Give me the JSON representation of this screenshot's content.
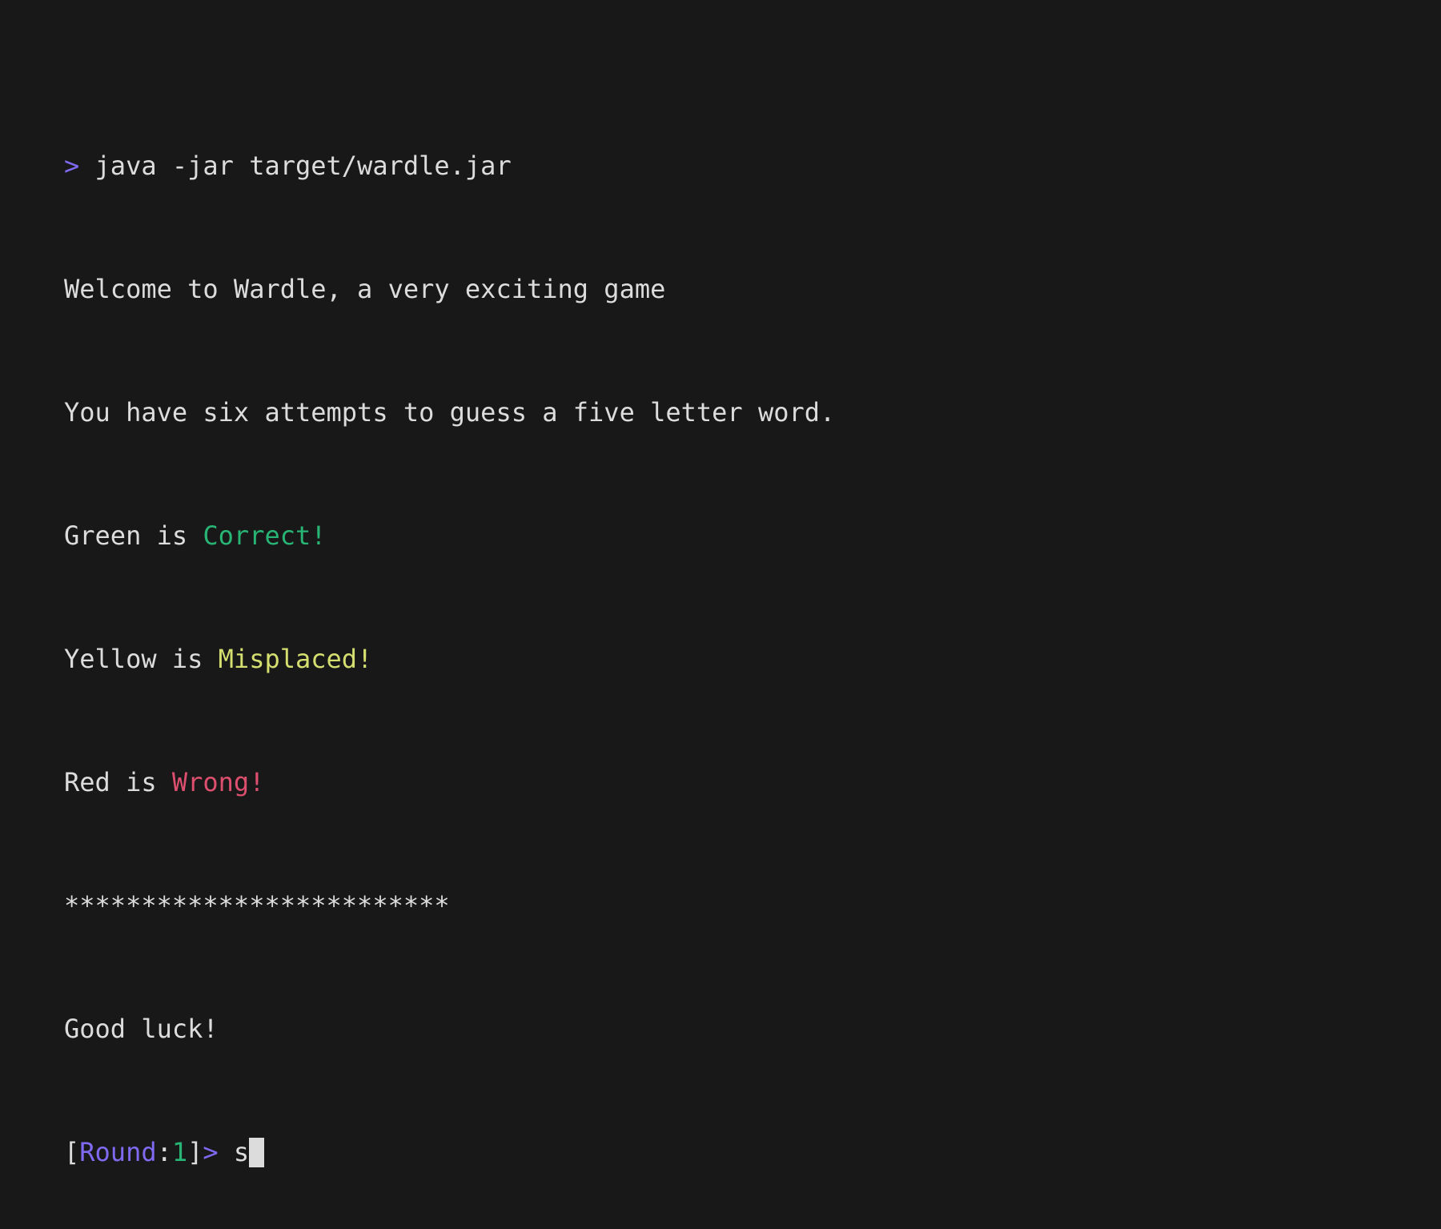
{
  "colors": {
    "background": "#181818",
    "foreground": "#dcdcdc",
    "prompt": "#7f6bf2",
    "correct": "#28b474",
    "misplaced": "#d4df6f",
    "wrong": "#dd4f6e"
  },
  "command": {
    "prompt": ">",
    "text": "java -jar target/wardle.jar"
  },
  "output": {
    "welcome": "Welcome to Wardle, a very exciting game",
    "rules": "You have six attempts to guess a five letter word.",
    "legend": [
      {
        "prefix": "Green is ",
        "word": "Correct!",
        "color_key": "correct"
      },
      {
        "prefix": "Yellow is ",
        "word": "Misplaced!",
        "color_key": "misplaced"
      },
      {
        "prefix": "Red is ",
        "word": "Wrong!",
        "color_key": "wrong"
      }
    ],
    "separator": "*************************",
    "good_luck": "Good luck!"
  },
  "round_prompt": {
    "open_bracket": "[",
    "label": "Round",
    "colon": ":",
    "number": "1",
    "close": "]",
    "arrow": ">",
    "input_value": "s"
  }
}
